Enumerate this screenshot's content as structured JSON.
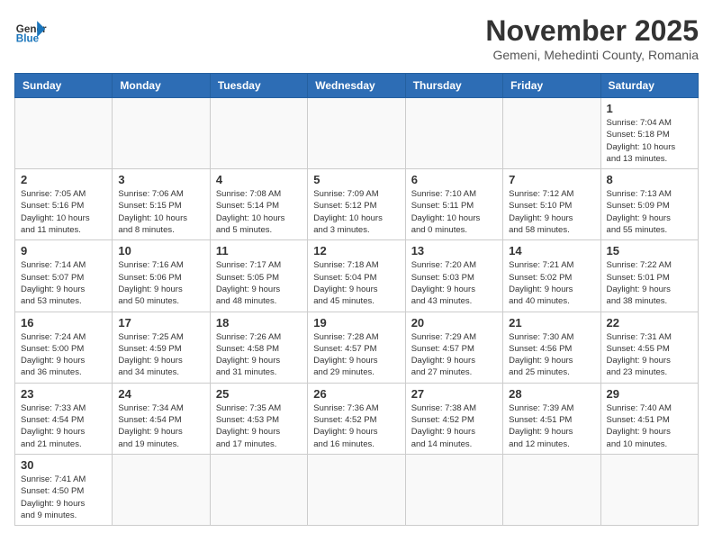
{
  "header": {
    "logo_general": "General",
    "logo_blue": "Blue",
    "month_title": "November 2025",
    "location": "Gemeni, Mehedinti County, Romania"
  },
  "weekdays": [
    "Sunday",
    "Monday",
    "Tuesday",
    "Wednesday",
    "Thursday",
    "Friday",
    "Saturday"
  ],
  "weeks": [
    [
      {
        "day": "",
        "info": ""
      },
      {
        "day": "",
        "info": ""
      },
      {
        "day": "",
        "info": ""
      },
      {
        "day": "",
        "info": ""
      },
      {
        "day": "",
        "info": ""
      },
      {
        "day": "",
        "info": ""
      },
      {
        "day": "1",
        "info": "Sunrise: 7:04 AM\nSunset: 5:18 PM\nDaylight: 10 hours\nand 13 minutes."
      }
    ],
    [
      {
        "day": "2",
        "info": "Sunrise: 7:05 AM\nSunset: 5:16 PM\nDaylight: 10 hours\nand 11 minutes."
      },
      {
        "day": "3",
        "info": "Sunrise: 7:06 AM\nSunset: 5:15 PM\nDaylight: 10 hours\nand 8 minutes."
      },
      {
        "day": "4",
        "info": "Sunrise: 7:08 AM\nSunset: 5:14 PM\nDaylight: 10 hours\nand 5 minutes."
      },
      {
        "day": "5",
        "info": "Sunrise: 7:09 AM\nSunset: 5:12 PM\nDaylight: 10 hours\nand 3 minutes."
      },
      {
        "day": "6",
        "info": "Sunrise: 7:10 AM\nSunset: 5:11 PM\nDaylight: 10 hours\nand 0 minutes."
      },
      {
        "day": "7",
        "info": "Sunrise: 7:12 AM\nSunset: 5:10 PM\nDaylight: 9 hours\nand 58 minutes."
      },
      {
        "day": "8",
        "info": "Sunrise: 7:13 AM\nSunset: 5:09 PM\nDaylight: 9 hours\nand 55 minutes."
      }
    ],
    [
      {
        "day": "9",
        "info": "Sunrise: 7:14 AM\nSunset: 5:07 PM\nDaylight: 9 hours\nand 53 minutes."
      },
      {
        "day": "10",
        "info": "Sunrise: 7:16 AM\nSunset: 5:06 PM\nDaylight: 9 hours\nand 50 minutes."
      },
      {
        "day": "11",
        "info": "Sunrise: 7:17 AM\nSunset: 5:05 PM\nDaylight: 9 hours\nand 48 minutes."
      },
      {
        "day": "12",
        "info": "Sunrise: 7:18 AM\nSunset: 5:04 PM\nDaylight: 9 hours\nand 45 minutes."
      },
      {
        "day": "13",
        "info": "Sunrise: 7:20 AM\nSunset: 5:03 PM\nDaylight: 9 hours\nand 43 minutes."
      },
      {
        "day": "14",
        "info": "Sunrise: 7:21 AM\nSunset: 5:02 PM\nDaylight: 9 hours\nand 40 minutes."
      },
      {
        "day": "15",
        "info": "Sunrise: 7:22 AM\nSunset: 5:01 PM\nDaylight: 9 hours\nand 38 minutes."
      }
    ],
    [
      {
        "day": "16",
        "info": "Sunrise: 7:24 AM\nSunset: 5:00 PM\nDaylight: 9 hours\nand 36 minutes."
      },
      {
        "day": "17",
        "info": "Sunrise: 7:25 AM\nSunset: 4:59 PM\nDaylight: 9 hours\nand 34 minutes."
      },
      {
        "day": "18",
        "info": "Sunrise: 7:26 AM\nSunset: 4:58 PM\nDaylight: 9 hours\nand 31 minutes."
      },
      {
        "day": "19",
        "info": "Sunrise: 7:28 AM\nSunset: 4:57 PM\nDaylight: 9 hours\nand 29 minutes."
      },
      {
        "day": "20",
        "info": "Sunrise: 7:29 AM\nSunset: 4:57 PM\nDaylight: 9 hours\nand 27 minutes."
      },
      {
        "day": "21",
        "info": "Sunrise: 7:30 AM\nSunset: 4:56 PM\nDaylight: 9 hours\nand 25 minutes."
      },
      {
        "day": "22",
        "info": "Sunrise: 7:31 AM\nSunset: 4:55 PM\nDaylight: 9 hours\nand 23 minutes."
      }
    ],
    [
      {
        "day": "23",
        "info": "Sunrise: 7:33 AM\nSunset: 4:54 PM\nDaylight: 9 hours\nand 21 minutes."
      },
      {
        "day": "24",
        "info": "Sunrise: 7:34 AM\nSunset: 4:54 PM\nDaylight: 9 hours\nand 19 minutes."
      },
      {
        "day": "25",
        "info": "Sunrise: 7:35 AM\nSunset: 4:53 PM\nDaylight: 9 hours\nand 17 minutes."
      },
      {
        "day": "26",
        "info": "Sunrise: 7:36 AM\nSunset: 4:52 PM\nDaylight: 9 hours\nand 16 minutes."
      },
      {
        "day": "27",
        "info": "Sunrise: 7:38 AM\nSunset: 4:52 PM\nDaylight: 9 hours\nand 14 minutes."
      },
      {
        "day": "28",
        "info": "Sunrise: 7:39 AM\nSunset: 4:51 PM\nDaylight: 9 hours\nand 12 minutes."
      },
      {
        "day": "29",
        "info": "Sunrise: 7:40 AM\nSunset: 4:51 PM\nDaylight: 9 hours\nand 10 minutes."
      }
    ],
    [
      {
        "day": "30",
        "info": "Sunrise: 7:41 AM\nSunset: 4:50 PM\nDaylight: 9 hours\nand 9 minutes."
      },
      {
        "day": "",
        "info": ""
      },
      {
        "day": "",
        "info": ""
      },
      {
        "day": "",
        "info": ""
      },
      {
        "day": "",
        "info": ""
      },
      {
        "day": "",
        "info": ""
      },
      {
        "day": "",
        "info": ""
      }
    ]
  ]
}
